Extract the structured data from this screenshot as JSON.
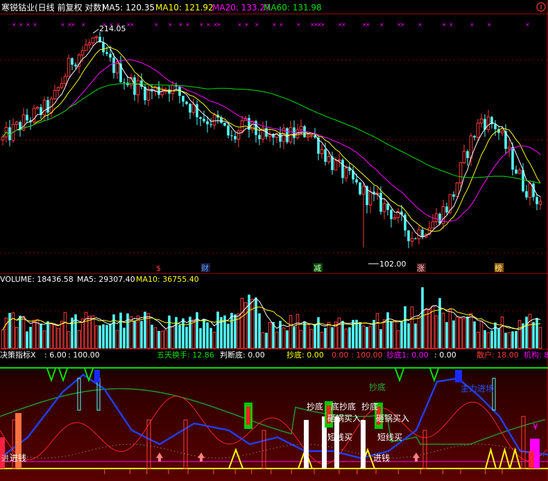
{
  "main_header": {
    "title": "寒锐钴业(日线 前复权 对数)",
    "ma5_label": "MA5: 120.35",
    "ma10_label": "MA10: 121.92",
    "ma20_label": "MA20: 133.29",
    "ma60_label": "MA60: 131.98"
  },
  "volume_header": {
    "label": "VOLUME: 18436.58",
    "ma5_label": "MA5: 29307.40",
    "ma10_label": "MA10: 36755.40"
  },
  "indicator_header": {
    "name": "决策指标X",
    "v1": ": 6.00",
    "v2": ": 100.00",
    "wuri_label": "五天换手: 12.86",
    "pandi_label": "判断底: 0.00",
    "chaodi_label": "抄底: 0.00",
    "zero_label": "0.00 : 100.00",
    "chaodi1_label": "抄底1: 0.00",
    "zero2_label": ": 0.00",
    "sanhu_label": "散户: 18.00",
    "jigou_label": "机构: 8"
  },
  "annotations": {
    "max_label": "214.05",
    "min_label": "102.00",
    "markers": [
      "$",
      "财",
      "减",
      "涨",
      "榜"
    ],
    "chaodi_text": "抄底",
    "dibottom_text": "底抄底",
    "chaodi_small": "抄底",
    "tieguo": "砸锅买入",
    "tieguo2": "砸锅买入",
    "duanxian": "短线买",
    "duanxian2": "短线买",
    "jinqian": "进钱",
    "jinqian2": "进钱",
    "zhuli": "主力进场",
    "yen": "¥",
    "misc_glyph": "进"
  },
  "colors": {
    "up": "#ff3c3c",
    "down": "#54ffff",
    "ma5": "#ffffff",
    "ma10": "#ffff00",
    "ma20": "#ff00ff",
    "ma60": "#00e000",
    "grid": "#7f0000",
    "panel_bg2": "#3a0000"
  },
  "chart_data": {
    "type": "candlestick",
    "scale": "log",
    "price_range": [
      95,
      230
    ],
    "max_price": 214.05,
    "min_price": 102.0,
    "last_close": 120.35,
    "indicator_range": [
      0,
      100
    ]
  }
}
